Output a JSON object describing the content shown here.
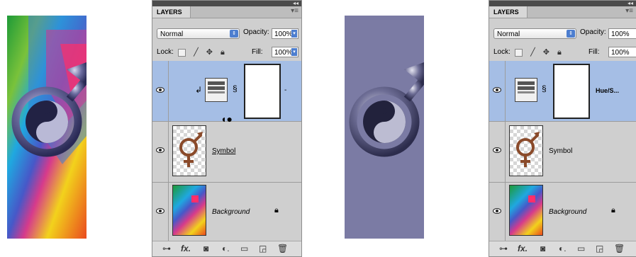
{
  "left_panel": {
    "tab_label": "LAYERS",
    "blend_mode": "Normal",
    "opacity_label": "Opacity:",
    "opacity_value": "100%",
    "lock_label": "Lock:",
    "fill_label": "Fill:",
    "fill_value": "100%",
    "layers": [
      {
        "name": "",
        "type": "adjustment",
        "selected": true
      },
      {
        "name": "Symbol",
        "type": "image",
        "selected": false
      },
      {
        "name": "Background",
        "type": "background",
        "selected": false,
        "locked": true
      }
    ]
  },
  "right_panel": {
    "tab_label": "LAYERS",
    "blend_mode": "Normal",
    "opacity_label": "Opacity:",
    "opacity_value": "100%",
    "lock_label": "Lock:",
    "fill_label": "Fill:",
    "fill_value": "100%",
    "layers": [
      {
        "name": "Hue/S...",
        "type": "adjustment",
        "selected": true
      },
      {
        "name": "Symbol",
        "type": "image",
        "selected": false
      },
      {
        "name": "Background",
        "type": "background",
        "selected": false,
        "locked": true
      }
    ]
  },
  "icons": {
    "menu": "panel-menu-icon",
    "eye": "visibility-eye-icon",
    "lock": "lock-icon",
    "link": "chain-link-icon",
    "cursor": "clipping-cursor-icon",
    "footer": [
      "link-layers-icon",
      "fx-icon",
      "add-mask-icon",
      "adjustment-layer-icon",
      "group-icon",
      "new-layer-icon",
      "trash-icon"
    ]
  },
  "colors": {
    "selected_layer": "#a5bee5",
    "panel_bg": "#cfcfcf",
    "right_artwork_bg": "#7b7ba4",
    "blue_control": "#4d7ecf"
  }
}
